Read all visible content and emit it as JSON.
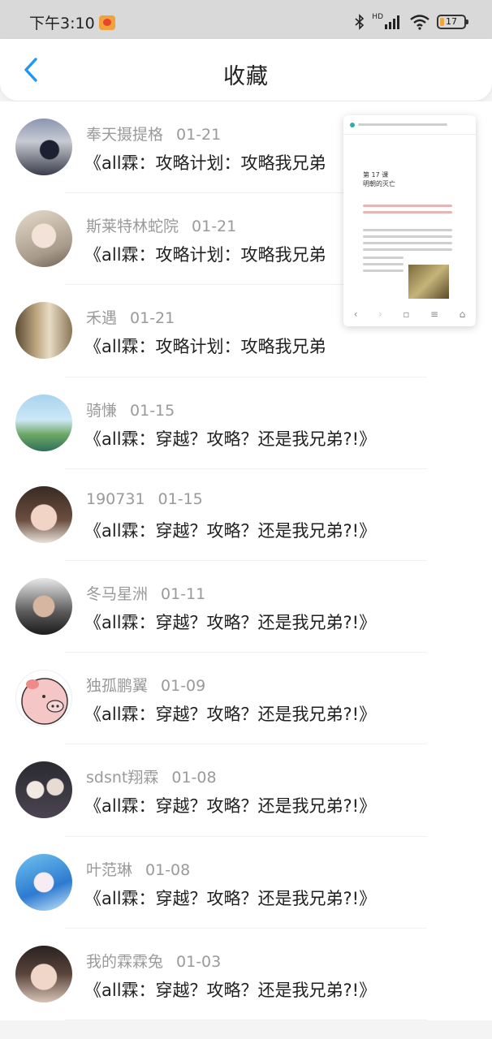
{
  "status_bar": {
    "time": "下午3:10",
    "network": "HD",
    "battery": "17",
    "battery_level": 0.17,
    "accent_color": "#f0a63a"
  },
  "header": {
    "title": "收藏",
    "back_icon": "chevron-left-icon",
    "back_color": "#2196f3"
  },
  "favorites": [
    {
      "author": "奉天摄提格",
      "date": "01-21",
      "title": "《all霖：攻略计划：攻略我兄弟",
      "avatar": "avatar-photo"
    },
    {
      "author": "斯莱特林蛇院",
      "date": "01-21",
      "title": "《all霖：攻略计划：攻略我兄弟",
      "avatar": "avatar-photo"
    },
    {
      "author": "禾遇",
      "date": "01-21",
      "title": "《all霖：攻略计划：攻略我兄弟",
      "avatar": "avatar-photo"
    },
    {
      "author": "骑慊",
      "date": "01-15",
      "title": "《all霖：穿越？攻略？还是我兄弟?!》",
      "avatar": "avatar-photo"
    },
    {
      "author": "190731",
      "date": "01-15",
      "title": "《all霖：穿越？攻略？还是我兄弟?!》",
      "avatar": "avatar-photo"
    },
    {
      "author": "冬马星洲",
      "date": "01-11",
      "title": "《all霖：穿越？攻略？还是我兄弟?!》",
      "avatar": "avatar-photo"
    },
    {
      "author": "独孤鹏翼",
      "date": "01-09",
      "title": "《all霖：穿越？攻略？还是我兄弟?!》",
      "avatar": "avatar-cartoon-pig"
    },
    {
      "author": "sdsnt翔霖",
      "date": "01-08",
      "title": "《all霖：穿越？攻略？还是我兄弟?!》",
      "avatar": "avatar-photo"
    },
    {
      "author": "叶范琳",
      "date": "01-08",
      "title": "《all霖：穿越？攻略？还是我兄弟?!》",
      "avatar": "avatar-photo"
    },
    {
      "author": "我的霖霖兔",
      "date": "01-03",
      "title": "《all霖：穿越？攻略？还是我兄弟?!》",
      "avatar": "avatar-photo"
    }
  ],
  "mini_window": {
    "lesson_title": "第 17 课\n明朝的灭亡",
    "nav_icons": [
      "back-icon",
      "forward-icon",
      "tabs-icon",
      "menu-icon",
      "home-icon"
    ]
  }
}
